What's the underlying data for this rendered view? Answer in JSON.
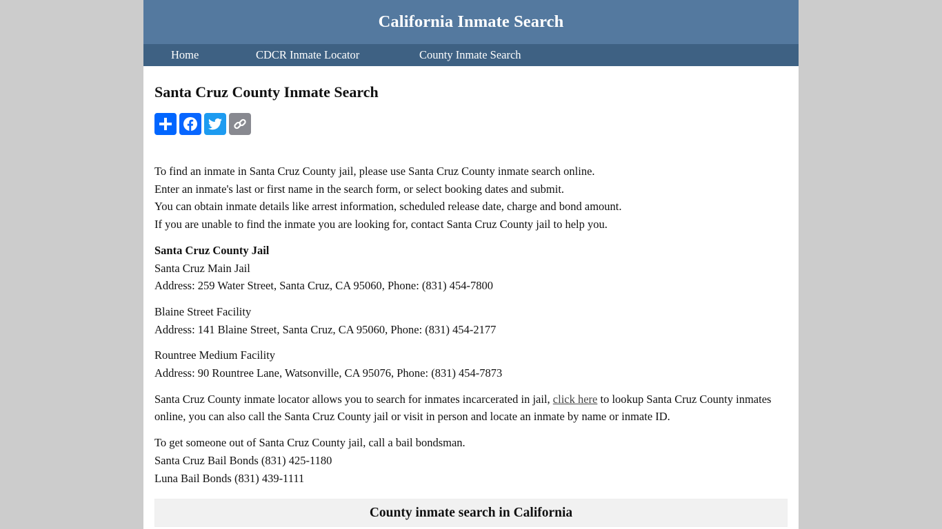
{
  "header": {
    "title": "California Inmate Search"
  },
  "nav": {
    "items": [
      {
        "label": "Home"
      },
      {
        "label": "CDCR Inmate Locator"
      },
      {
        "label": "County Inmate Search"
      }
    ]
  },
  "main": {
    "title": "Santa Cruz County Inmate Search",
    "share_buttons": [
      {
        "icon": "share-plus-icon",
        "label": "Share",
        "color": "#0166ff"
      },
      {
        "icon": "facebook-icon",
        "label": "Facebook",
        "color": "#0866ff"
      },
      {
        "icon": "twitter-icon",
        "label": "Twitter",
        "color": "#1d9bf0"
      },
      {
        "icon": "copy-link-icon",
        "label": "Copy Link",
        "color": "#888990"
      }
    ],
    "intro_lines": [
      "To find an inmate in Santa Cruz County jail, please use Santa Cruz County inmate search online.",
      "Enter an inmate's last or first name in the search form, or select booking dates and submit.",
      "You can obtain inmate details like arrest information, scheduled release date, charge and bond amount.",
      "If you are unable to find the inmate you are looking for, contact Santa Cruz County jail to help you."
    ],
    "jail_heading": "Santa Cruz County Jail",
    "facilities": [
      {
        "name": "Santa Cruz Main Jail",
        "address": "Address: 259 Water Street, Santa Cruz, CA 95060, Phone: (831) 454-7800"
      },
      {
        "name": "Blaine Street Facility",
        "address": "Address: 141 Blaine Street, Santa Cruz, CA 95060, Phone: (831) 454-2177"
      },
      {
        "name": "Rountree Medium Facility",
        "address": "Address: 90 Rountree Lane, Watsonville, CA 95076, Phone: (831) 454-7873"
      }
    ],
    "locator": {
      "before": "Santa Cruz County inmate locator allows you to search for inmates incarcerated in jail, ",
      "link_text": "click here",
      "after": " to lookup Santa Cruz County inmates online, you can also call the Santa Cruz County jail or visit in person and locate an inmate by name or inmate ID."
    },
    "bail": {
      "intro": "To get someone out of Santa Cruz County jail, call a bail bondsman.",
      "bondsmen": [
        "Santa Cruz Bail Bonds (831) 425-1180",
        "Luna Bail Bonds (831) 439-1111"
      ]
    },
    "county_section_title": "County inmate search in California"
  }
}
